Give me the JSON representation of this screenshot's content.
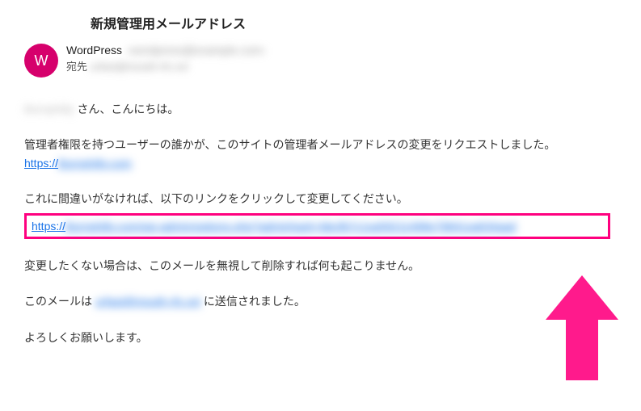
{
  "subject": "新規管理用メールアドレス",
  "avatar_letter": "W",
  "sender": {
    "name": "WordPress",
    "address_blur": "‹wordpress@example.com›"
  },
  "recipient": {
    "label": "宛先",
    "address_blur": "urfast@mouth-rfx.xxt"
  },
  "body": {
    "greeting_blur": "Bornphilly",
    "greeting_tail": " さん、こんにちは。",
    "p1": "管理者権限を持つユーザーの誰かが、このサイトの管理者メールアドレスの変更をリクエストしました。",
    "link1_proto": "https://",
    "link1_blur": "Bornphilly.com",
    "p2": "これに間違いがなければ、以下のリンクをクリックして変更してください。",
    "link2_proto": "https://",
    "link2_blur": "Bornphilly.com/wp-admin/options.php?adminhash=bbcfb7c1sa59211498e79841sa634aad",
    "p3": "変更したくない場合は、このメールを無視して削除すれば何も起こりません。",
    "p4_pre": "このメールは ",
    "p4_link_blur": "urfast@mouth-rfx.xxt",
    "p4_post": " に送信されました。",
    "p5": "よろしくお願いします。"
  },
  "colors": {
    "accent": "#ff007f",
    "avatar": "#d6006c",
    "link": "#1a73e8"
  }
}
